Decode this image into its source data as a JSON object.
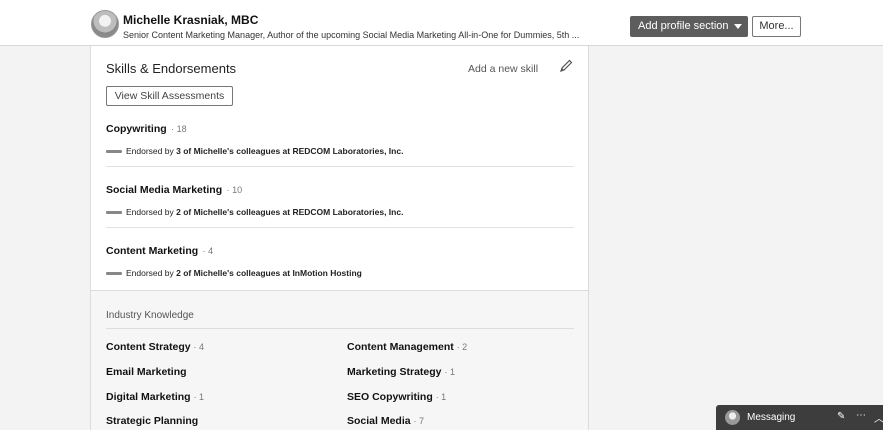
{
  "profile": {
    "name": "Michelle Krasniak, MBC",
    "headline": "Senior Content Marketing Manager, Author of the upcoming Social Media Marketing All-in-One for Dummies, 5th ..."
  },
  "topbar": {
    "add_section_label": "Add profile section",
    "more_label": "More..."
  },
  "skills": {
    "title": "Skills & Endorsements",
    "add_skill_label": "Add a new skill",
    "view_assessments_label": "View Skill Assessments",
    "items": [
      {
        "name": "Copywriting",
        "count": "· 18",
        "endorse_prefix": "Endorsed by ",
        "endorse_bold": "3 of Michelle's colleagues at REDCOM Laboratories, Inc."
      },
      {
        "name": "Social Media Marketing",
        "count": "· 10",
        "endorse_prefix": "Endorsed by ",
        "endorse_bold": "2 of Michelle's colleagues at REDCOM Laboratories, Inc."
      },
      {
        "name": "Content Marketing",
        "count": "· 4",
        "endorse_prefix": "Endorsed by ",
        "endorse_bold": "2 of Michelle's colleagues at InMotion Hosting"
      }
    ]
  },
  "industry_knowledge": {
    "title": "Industry Knowledge",
    "items": [
      {
        "name": "Content Strategy",
        "count": "· 4"
      },
      {
        "name": "Content Management",
        "count": "· 2"
      },
      {
        "name": "Email Marketing",
        "count": ""
      },
      {
        "name": "Marketing Strategy",
        "count": "· 1"
      },
      {
        "name": "Digital Marketing",
        "count": "· 1"
      },
      {
        "name": "SEO Copywriting",
        "count": "· 1"
      },
      {
        "name": "Strategic Planning",
        "count": ""
      },
      {
        "name": "Social Media",
        "count": "· 7"
      }
    ]
  },
  "messaging": {
    "label": "Messaging",
    "compose_icon": "compose-icon",
    "more_icon": "ellipsis-icon",
    "expand_icon": "chevron-up-icon"
  }
}
